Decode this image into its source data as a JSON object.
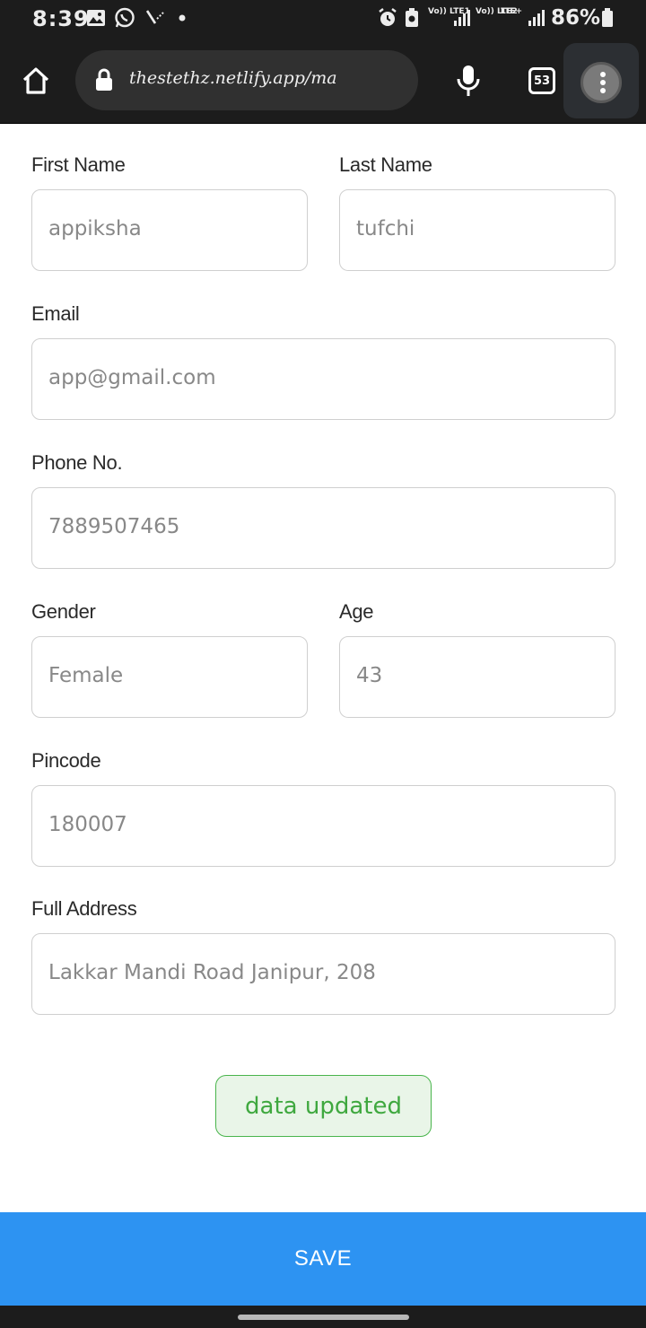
{
  "status_bar": {
    "time": "8:39",
    "network_1": "Vo)) LTE1",
    "network_2": "Vo)) LTE2",
    "network_2_type": "LTE+",
    "battery": "86%"
  },
  "browser": {
    "url": "thestethz.netlify.app/ma",
    "tab_count": "53"
  },
  "form": {
    "first_name": {
      "label": "First Name",
      "value": "appiksha"
    },
    "last_name": {
      "label": "Last Name",
      "value": "tufchi"
    },
    "email": {
      "label": "Email",
      "value": "app@gmail.com"
    },
    "phone": {
      "label": "Phone No.",
      "value": "7889507465"
    },
    "gender": {
      "label": "Gender",
      "value": "Female"
    },
    "age": {
      "label": "Age",
      "value": "43"
    },
    "pincode": {
      "label": "Pincode",
      "value": "180007"
    },
    "address": {
      "label": "Full Address",
      "value": "Lakkar Mandi Road Janipur, 208"
    }
  },
  "toast": {
    "message": "data updated"
  },
  "save_button": {
    "label": "SAVE"
  },
  "colors": {
    "primary": "#2d93f2",
    "success": "#3fa83f",
    "success_bg": "#e9f5e8",
    "chrome": "#1c1c1c"
  }
}
